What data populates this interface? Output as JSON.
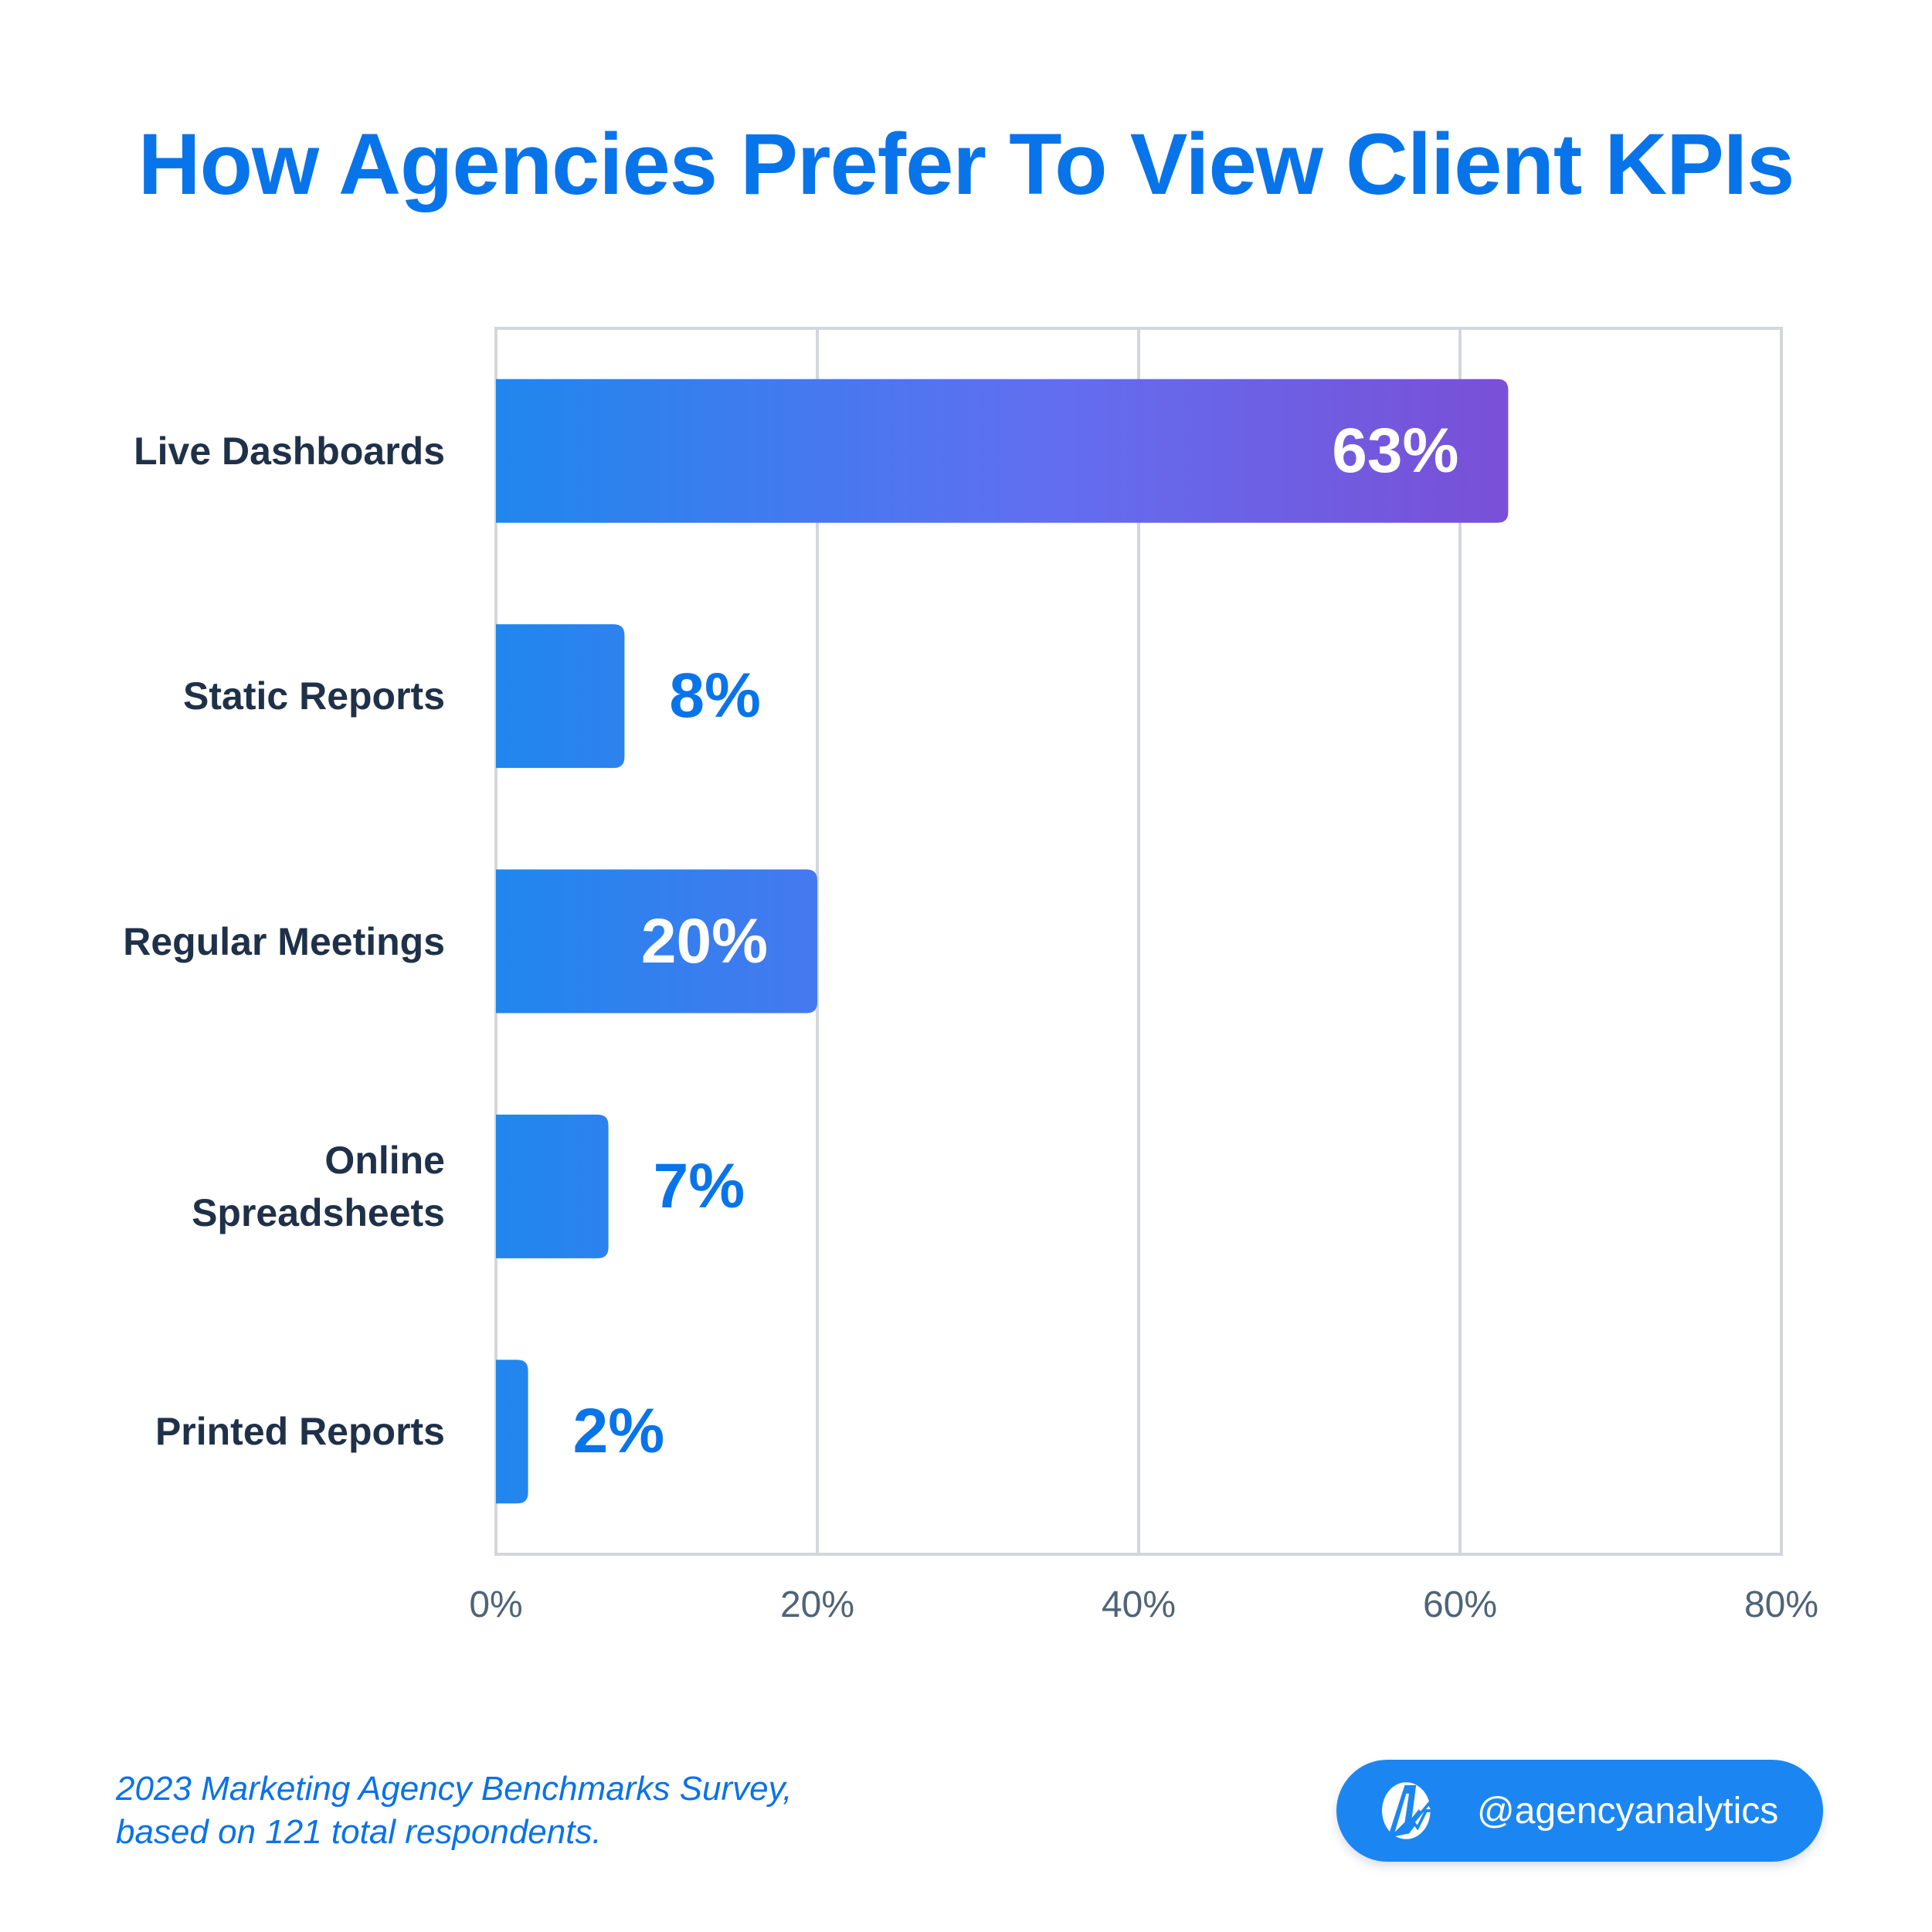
{
  "title": "How Agencies Prefer To View Client KPIs",
  "chart_data": {
    "type": "bar",
    "orientation": "horizontal",
    "title": "How Agencies Prefer To View Client KPIs",
    "categories": [
      "Live Dashboards",
      "Static Reports",
      "Regular Meetings",
      "Online Spreadsheets",
      "Printed Reports"
    ],
    "category_lines": [
      [
        "Live Dashboards"
      ],
      [
        "Static Reports"
      ],
      [
        "Regular Meetings"
      ],
      [
        "Online",
        "Spreadsheets"
      ],
      [
        "Printed Reports"
      ]
    ],
    "values": [
      63,
      8,
      20,
      7,
      2
    ],
    "data_labels": [
      "63%",
      "8%",
      "20%",
      "7%",
      "2%"
    ],
    "xlabel": "",
    "ylabel": "",
    "xlim": [
      0,
      80
    ],
    "xticks": [
      0,
      20,
      40,
      60,
      80
    ],
    "xtick_labels": [
      "0%",
      "20%",
      "40%",
      "60%",
      "80%"
    ],
    "grid": true,
    "colors": {
      "gradient_start": "#1f87ee",
      "gradient_mid": "#626ef0",
      "gradient_end": "#7a4fd6",
      "label_inside": "#ffffff",
      "label_outside": "#0874ea",
      "grid": "#d3d7dc"
    }
  },
  "footnote": {
    "line1": "2023 Marketing Agency Benchmarks Survey,",
    "line2": "based on 121 total respondents."
  },
  "badge": {
    "icon": "agencyanalytics-logo-icon",
    "text": "@agencyanalytics"
  }
}
